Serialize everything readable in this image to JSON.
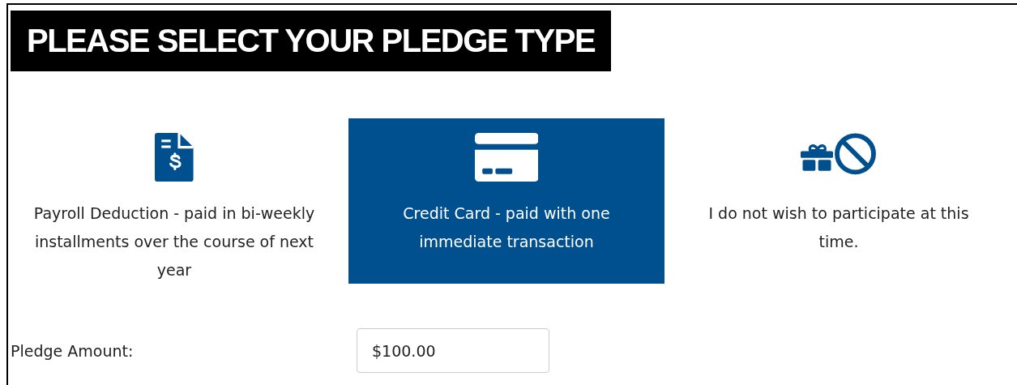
{
  "heading": "PLEASE SELECT YOUR PLEDGE TYPE",
  "pledge_types": [
    {
      "kind": "payroll",
      "label": "Payroll Deduction - paid in bi-weekly installments over the course of next year",
      "selected": false
    },
    {
      "kind": "card",
      "label": "Credit Card - paid with one immediate transaction",
      "selected": true
    },
    {
      "kind": "decline",
      "label": "I do not wish to participate at this time.",
      "selected": false
    }
  ],
  "pledge_amount": {
    "label": "Pledge Amount:",
    "value": "$100.00"
  }
}
